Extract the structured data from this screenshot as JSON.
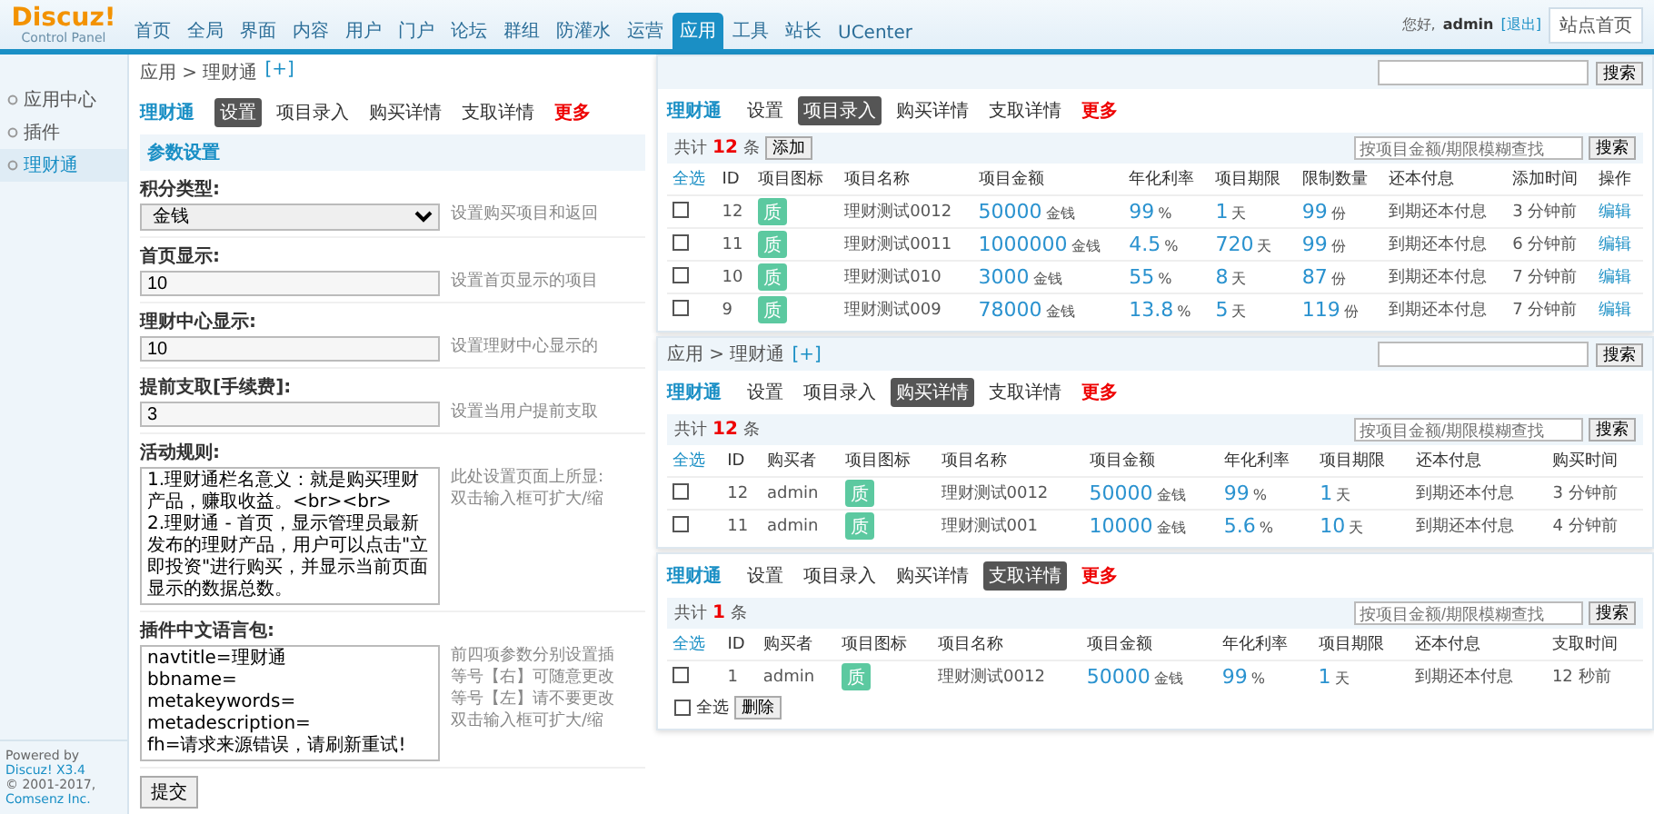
{
  "header": {
    "logo": "Discuz!",
    "logo_sub": "Control Panel",
    "nav": [
      {
        "label": "首页",
        "selected": false
      },
      {
        "label": "全局",
        "selected": false
      },
      {
        "label": "界面",
        "selected": false
      },
      {
        "label": "内容",
        "selected": false
      },
      {
        "label": "用户",
        "selected": false
      },
      {
        "label": "门户",
        "selected": false
      },
      {
        "label": "论坛",
        "selected": false
      },
      {
        "label": "群组",
        "selected": false
      },
      {
        "label": "防灌水",
        "selected": false
      },
      {
        "label": "运营",
        "selected": false
      },
      {
        "label": "应用",
        "selected": true
      },
      {
        "label": "工具",
        "selected": false
      },
      {
        "label": "站长",
        "selected": false
      },
      {
        "label": "UCenter",
        "selected": false
      }
    ],
    "greeting": "您好,",
    "user": "admin",
    "logout": "[退出]",
    "home_button": "站点首页"
  },
  "sidebar": {
    "items": [
      {
        "label": "应用中心",
        "selected": false
      },
      {
        "label": "插件",
        "selected": false
      },
      {
        "label": "理财通",
        "selected": true
      }
    ],
    "powered": "Powered by",
    "powered_link": "Discuz! X3.4",
    "copyright": "© 2001-2017,",
    "company": "Comsenz Inc."
  },
  "settings": {
    "breadcrumb": "应用 > 理财通",
    "add": "[+]",
    "title": "理财通",
    "tabs": [
      {
        "kind": "tab",
        "label": "设置",
        "selected": true
      },
      {
        "kind": "tab",
        "label": "项目录入",
        "selected": false
      },
      {
        "kind": "tab",
        "label": "购买详情",
        "selected": false
      },
      {
        "kind": "tab",
        "label": "支取详情",
        "selected": false
      },
      {
        "kind": "more",
        "label": "更多",
        "selected": false
      }
    ],
    "section": "参数设置",
    "fields": [
      {
        "kind": "select",
        "label": "积分类型:",
        "value": "金钱",
        "hints": [
          "设置购买项目和返回"
        ]
      },
      {
        "kind": "input",
        "label": "首页显示:",
        "value": "10",
        "hints": [
          "设置首页显示的项目"
        ]
      },
      {
        "kind": "input",
        "label": "理财中心显示:",
        "value": "10",
        "hints": [
          "设置理财中心显示的"
        ]
      },
      {
        "kind": "input",
        "label": "提前支取[手续费]:",
        "value": "3",
        "hints": [
          "设置当用户提前支取"
        ]
      },
      {
        "kind": "textarea",
        "label": "活动规则:",
        "value": "1.理财通栏名意义：就是购买理财产品，赚取收益。<br><br>\n2.理财通 - 首页，显示管理员最新发布的理财产品，用户可以点击\"立即投资\"进行购买，并显示当前页面显示的数据总数。",
        "hints": [
          "此处设置页面上所显:",
          "双击输入框可扩大/缩"
        ]
      },
      {
        "kind": "textarea",
        "label": "插件中文语言包:",
        "value": "navtitle=理财通\nbbname=\nmetakeywords=\nmetadescription=\nfh=请求来源错误，请刷新重试!",
        "hints": [
          "前四项参数分别设置插",
          "等号【右】可随意更改",
          "等号【左】请不要更改",
          "双击输入框可扩大/缩"
        ]
      }
    ],
    "submit": "提交"
  },
  "panels": [
    {
      "top_bar": {
        "search_button": "搜索"
      },
      "title": "理财通",
      "tabs": [
        {
          "kind": "tab",
          "label": "设置",
          "selected": false
        },
        {
          "kind": "tab",
          "label": "项目录入",
          "selected": true
        },
        {
          "kind": "tab",
          "label": "购买详情",
          "selected": false
        },
        {
          "kind": "tab",
          "label": "支取详情",
          "selected": false
        },
        {
          "kind": "more",
          "label": "更多",
          "selected": false
        }
      ],
      "total_label": "共计",
      "total": "12",
      "total_unit": "条",
      "add_button": "添加",
      "search_placeholder": "按项目金额/期限模糊查找",
      "search_button": "搜索",
      "columns": [
        "全选",
        "ID",
        "项目图标",
        "项目名称",
        "项目金额",
        "年化利率",
        "项目期限",
        "限制数量",
        "还本付息",
        "添加时间",
        "操作"
      ],
      "rows": [
        {
          "cells": [
            {
              "kind": "check",
              "checked": false
            },
            {
              "kind": "text",
              "text": "12"
            },
            {
              "kind": "badge",
              "text": "质"
            },
            {
              "kind": "text",
              "text": "理财测试0012"
            },
            {
              "kind": "value",
              "text": "50000",
              "unit": "金钱"
            },
            {
              "kind": "value",
              "text": "99",
              "unit": "%"
            },
            {
              "kind": "value",
              "text": "1",
              "unit": "天"
            },
            {
              "kind": "value",
              "text": "99",
              "unit": "份"
            },
            {
              "kind": "text",
              "text": "到期还本付息"
            },
            {
              "kind": "text",
              "text": "3 分钟前"
            },
            {
              "kind": "link",
              "text": "编辑"
            }
          ]
        },
        {
          "cells": [
            {
              "kind": "check",
              "checked": false
            },
            {
              "kind": "text",
              "text": "11"
            },
            {
              "kind": "badge",
              "text": "质"
            },
            {
              "kind": "text",
              "text": "理财测试0011"
            },
            {
              "kind": "value",
              "text": "1000000",
              "unit": "金钱"
            },
            {
              "kind": "value",
              "text": "4.5",
              "unit": "%"
            },
            {
              "kind": "value",
              "text": "720",
              "unit": "天"
            },
            {
              "kind": "value",
              "text": "99",
              "unit": "份"
            },
            {
              "kind": "text",
              "text": "到期还本付息"
            },
            {
              "kind": "text",
              "text": "6 分钟前"
            },
            {
              "kind": "link",
              "text": "编辑"
            }
          ]
        },
        {
          "cells": [
            {
              "kind": "check",
              "checked": false
            },
            {
              "kind": "text",
              "text": "10"
            },
            {
              "kind": "badge",
              "text": "质"
            },
            {
              "kind": "text",
              "text": "理财测试010"
            },
            {
              "kind": "value",
              "text": "3000",
              "unit": "金钱"
            },
            {
              "kind": "value",
              "text": "55",
              "unit": "%"
            },
            {
              "kind": "value",
              "text": "8",
              "unit": "天"
            },
            {
              "kind": "value",
              "text": "87",
              "unit": "份"
            },
            {
              "kind": "text",
              "text": "到期还本付息"
            },
            {
              "kind": "text",
              "text": "7 分钟前"
            },
            {
              "kind": "link",
              "text": "编辑"
            }
          ]
        },
        {
          "cells": [
            {
              "kind": "check",
              "checked": false
            },
            {
              "kind": "text",
              "text": "9"
            },
            {
              "kind": "badge",
              "text": "质"
            },
            {
              "kind": "text",
              "text": "理财测试009"
            },
            {
              "kind": "value",
              "text": "78000",
              "unit": "金钱"
            },
            {
              "kind": "value",
              "text": "13.8",
              "unit": "%"
            },
            {
              "kind": "value",
              "text": "5",
              "unit": "天"
            },
            {
              "kind": "value",
              "text": "119",
              "unit": "份"
            },
            {
              "kind": "text",
              "text": "到期还本付息"
            },
            {
              "kind": "text",
              "text": "7 分钟前"
            },
            {
              "kind": "link",
              "text": "编辑"
            }
          ]
        }
      ]
    },
    {
      "top_bar": {
        "breadcrumb": "应用 > 理财通",
        "add": "[+]",
        "search_button": "搜索"
      },
      "title": "理财通",
      "tabs": [
        {
          "kind": "tab",
          "label": "设置",
          "selected": false
        },
        {
          "kind": "tab",
          "label": "项目录入",
          "selected": false
        },
        {
          "kind": "tab",
          "label": "购买详情",
          "selected": true
        },
        {
          "kind": "tab",
          "label": "支取详情",
          "selected": false
        },
        {
          "kind": "more",
          "label": "更多",
          "selected": false
        }
      ],
      "total_label": "共计",
      "total": "12",
      "total_unit": "条",
      "search_placeholder": "按项目金额/期限模糊查找",
      "search_button": "搜索",
      "columns": [
        "全选",
        "ID",
        "购买者",
        "项目图标",
        "项目名称",
        "项目金额",
        "年化利率",
        "项目期限",
        "还本付息",
        "购买时间"
      ],
      "rows": [
        {
          "cells": [
            {
              "kind": "check",
              "checked": false
            },
            {
              "kind": "text",
              "text": "12"
            },
            {
              "kind": "text",
              "text": "admin"
            },
            {
              "kind": "badge",
              "text": "质"
            },
            {
              "kind": "text",
              "text": "理财测试0012"
            },
            {
              "kind": "value",
              "text": "50000",
              "unit": "金钱"
            },
            {
              "kind": "value",
              "text": "99",
              "unit": "%"
            },
            {
              "kind": "value",
              "text": "1",
              "unit": "天"
            },
            {
              "kind": "text",
              "text": "到期还本付息"
            },
            {
              "kind": "text",
              "text": "3 分钟前"
            }
          ]
        },
        {
          "cells": [
            {
              "kind": "check",
              "checked": false
            },
            {
              "kind": "text",
              "text": "11"
            },
            {
              "kind": "text",
              "text": "admin"
            },
            {
              "kind": "badge",
              "text": "质"
            },
            {
              "kind": "text",
              "text": "理财测试001"
            },
            {
              "kind": "value",
              "text": "10000",
              "unit": "金钱"
            },
            {
              "kind": "value",
              "text": "5.6",
              "unit": "%"
            },
            {
              "kind": "value",
              "text": "10",
              "unit": "天"
            },
            {
              "kind": "text",
              "text": "到期还本付息"
            },
            {
              "kind": "text",
              "text": "4 分钟前"
            }
          ]
        }
      ]
    },
    {
      "title": "理财通",
      "tabs": [
        {
          "kind": "tab",
          "label": "设置",
          "selected": false
        },
        {
          "kind": "tab",
          "label": "项目录入",
          "selected": false
        },
        {
          "kind": "tab",
          "label": "购买详情",
          "selected": false
        },
        {
          "kind": "tab",
          "label": "支取详情",
          "selected": true
        },
        {
          "kind": "more",
          "label": "更多",
          "selected": false
        }
      ],
      "total_label": "共计",
      "total": "1",
      "total_unit": "条",
      "search_placeholder": "按项目金额/期限模糊查找",
      "search_button": "搜索",
      "columns": [
        "全选",
        "ID",
        "购买者",
        "项目图标",
        "项目名称",
        "项目金额",
        "年化利率",
        "项目期限",
        "还本付息",
        "支取时间"
      ],
      "rows": [
        {
          "cells": [
            {
              "kind": "check",
              "checked": false
            },
            {
              "kind": "text",
              "text": "1"
            },
            {
              "kind": "text",
              "text": "admin"
            },
            {
              "kind": "badge",
              "text": "质"
            },
            {
              "kind": "text",
              "text": "理财测试0012"
            },
            {
              "kind": "value",
              "text": "50000",
              "unit": "金钱"
            },
            {
              "kind": "value",
              "text": "99",
              "unit": "%"
            },
            {
              "kind": "value",
              "text": "1",
              "unit": "天"
            },
            {
              "kind": "text",
              "text": "到期还本付息"
            },
            {
              "kind": "text",
              "text": "12 秒前"
            }
          ]
        }
      ],
      "footer": {
        "checked": false,
        "label": "全选",
        "button": "删除"
      }
    }
  ]
}
